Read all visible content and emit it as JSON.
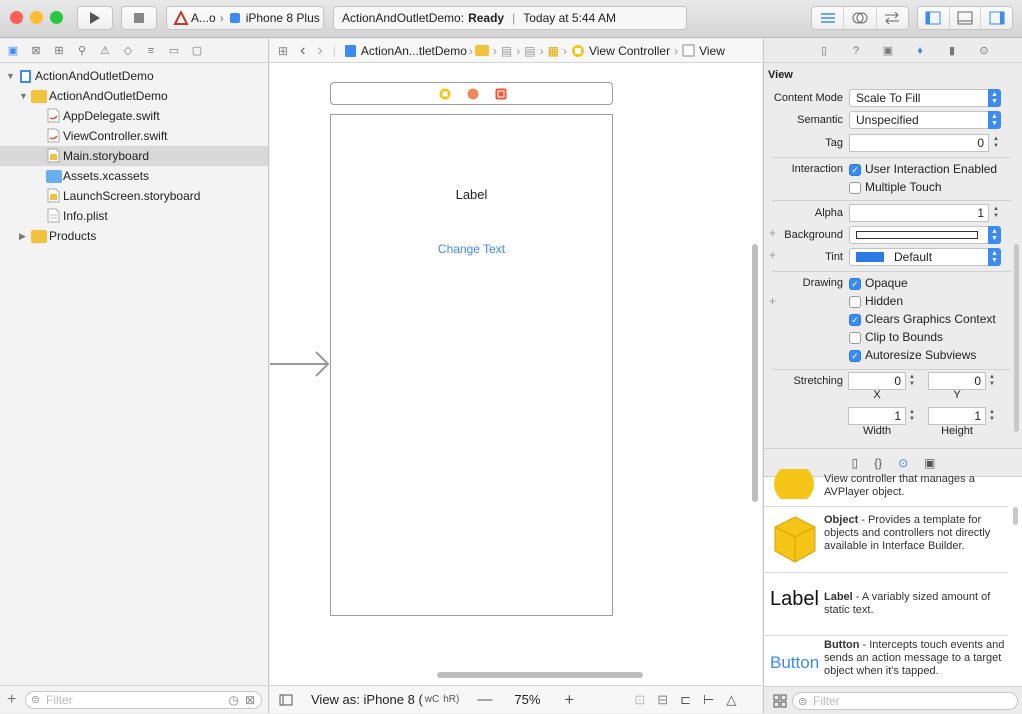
{
  "window": {
    "traffic_colors": {
      "close": "#fd5f57",
      "minimize": "#febc2e",
      "zoom": "#28c840"
    }
  },
  "toolbar": {
    "scheme_app": "A...o",
    "scheme_device": "iPhone 8 Plus",
    "activity_project": "ActionAndOutletDemo:",
    "activity_status": "Ready",
    "activity_time": "Today at 5:44 AM"
  },
  "navigator": {
    "items": [
      {
        "label": "ActionAndOutletDemo",
        "kind": "project"
      },
      {
        "label": "ActionAndOutletDemo",
        "kind": "folder"
      },
      {
        "label": "AppDelegate.swift",
        "kind": "swift"
      },
      {
        "label": "ViewController.swift",
        "kind": "swift"
      },
      {
        "label": "Main.storyboard",
        "kind": "storyboard"
      },
      {
        "label": "Assets.xcassets",
        "kind": "assets"
      },
      {
        "label": "LaunchScreen.storyboard",
        "kind": "storyboard"
      },
      {
        "label": "Info.plist",
        "kind": "plist"
      },
      {
        "label": "Products",
        "kind": "folder"
      }
    ],
    "filter_placeholder": "Filter"
  },
  "jumpbar": {
    "file": "ActionAn...tletDemo",
    "scene": "View Controller",
    "item": "View"
  },
  "canvas": {
    "label_text": "Label",
    "button_text": "Change Text"
  },
  "editor_bottom": {
    "view_as": "View as: iPhone 8 (",
    "w": "wC",
    "h": "hR)",
    "zoom": "75%"
  },
  "inspector": {
    "section": "View",
    "content_mode_label": "Content Mode",
    "content_mode": "Scale To Fill",
    "semantic_label": "Semantic",
    "semantic": "Unspecified",
    "tag_label": "Tag",
    "tag": "0",
    "interaction_label": "Interaction",
    "user_interaction": "User Interaction Enabled",
    "multiple_touch": "Multiple Touch",
    "alpha_label": "Alpha",
    "alpha": "1",
    "background_label": "Background",
    "tint_label": "Tint",
    "tint": "Default",
    "tint_color": "#2a7be6",
    "drawing_label": "Drawing",
    "opaque": "Opaque",
    "hidden": "Hidden",
    "clears_graphics": "Clears Graphics Context",
    "clip_bounds": "Clip to Bounds",
    "autoresize": "Autoresize Subviews",
    "stretching_label": "Stretching",
    "stretch_x": "0",
    "stretch_y": "0",
    "stretch_w": "1",
    "stretch_h": "1",
    "x_caption": "X",
    "y_caption": "Y",
    "width_caption": "Width",
    "height_caption": "Height"
  },
  "library": {
    "items": [
      {
        "big": "",
        "title": "",
        "desc": "View controller that manages a AVPlayer object."
      },
      {
        "big": "",
        "title": "Object",
        "desc": " - Provides a template for objects and controllers not directly available in Interface Builder."
      },
      {
        "big": "Label",
        "title": "Label",
        "desc": " - A variably sized amount of static text."
      },
      {
        "big": "Button",
        "title": "Button",
        "desc": " - Intercepts touch events and sends an action message to a target object when it's tapped."
      }
    ],
    "filter_placeholder": "Filter"
  }
}
